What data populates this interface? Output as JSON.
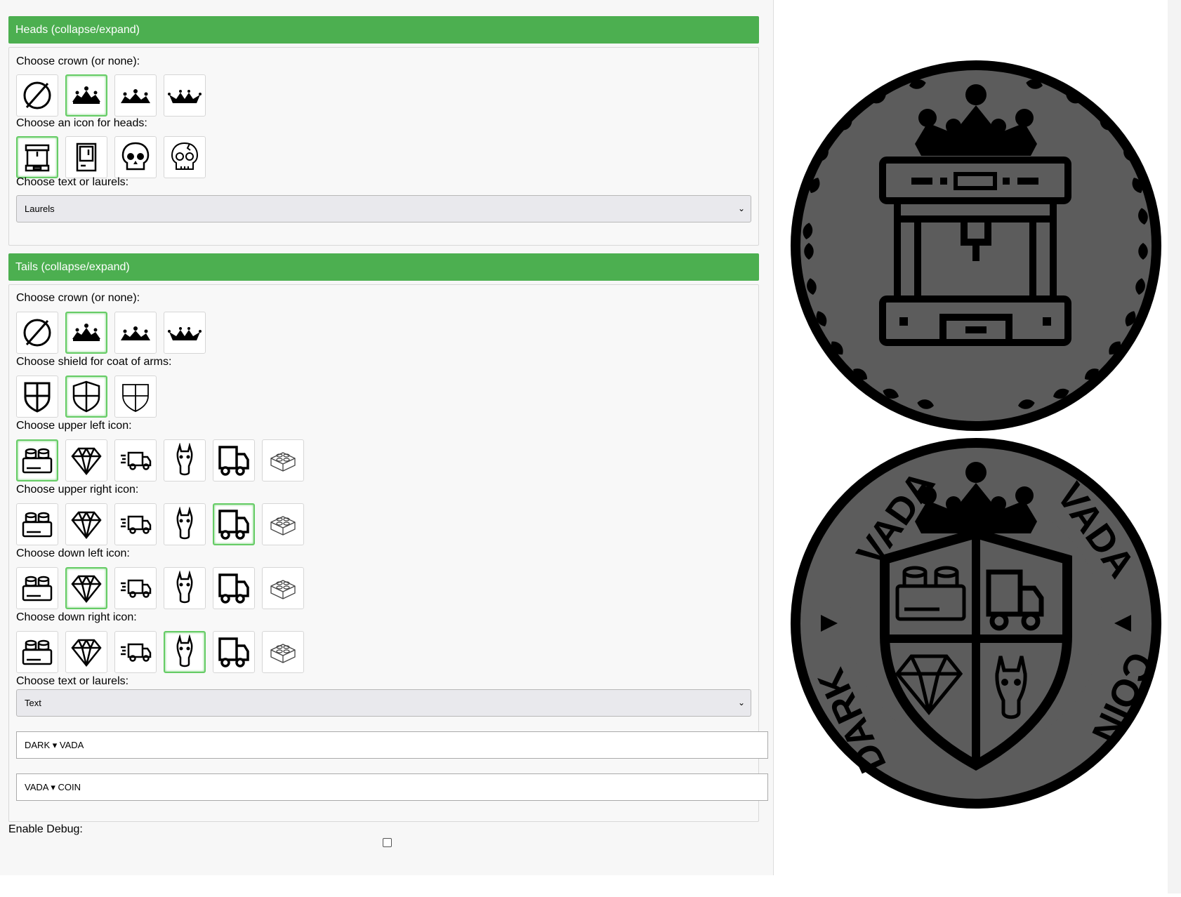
{
  "heads": {
    "header": "Heads (collapse/expand)",
    "crown_label": "Choose crown (or none):",
    "icon_label": "Choose an icon for heads:",
    "text_label": "Choose text or laurels:",
    "text_value": "Laurels"
  },
  "tails": {
    "header": "Tails (collapse/expand)",
    "crown_label": "Choose crown (or none):",
    "shield_label": "Choose shield for coat of arms:",
    "upper_left_label": "Choose upper left icon:",
    "upper_right_label": "Choose upper right icon:",
    "down_left_label": "Choose down left icon:",
    "down_right_label": "Choose down right icon:",
    "text_label": "Choose text or laurels:",
    "text_value": "Text",
    "text1": "DARK ▾ VADA",
    "text2": "VADA ▾ COIN"
  },
  "debug_label": "Enable Debug:",
  "coin_text": {
    "left_top": "VADA",
    "right_top": "VADA",
    "left_bottom": "DARK",
    "right_bottom": "COIN"
  },
  "icons": {
    "crowns": [
      "none-icon",
      "crown-1-icon",
      "crown-2-icon",
      "crown-3-icon"
    ],
    "heads": [
      "3d-printer-icon",
      "3d-printer-2-icon",
      "skull-icon",
      "skull-cracked-icon"
    ],
    "shields": [
      "shield-1-icon",
      "shield-2-icon",
      "shield-3-icon"
    ],
    "quarters": [
      "brick-icon",
      "diamond-icon",
      "delivery-truck-icon",
      "horse-icon",
      "truck-icon",
      "lego-brick-icon"
    ]
  },
  "colors": {
    "header_green": "#4caf50",
    "selected_border": "#66cc66",
    "coin_fill": "#5c5c5c"
  }
}
